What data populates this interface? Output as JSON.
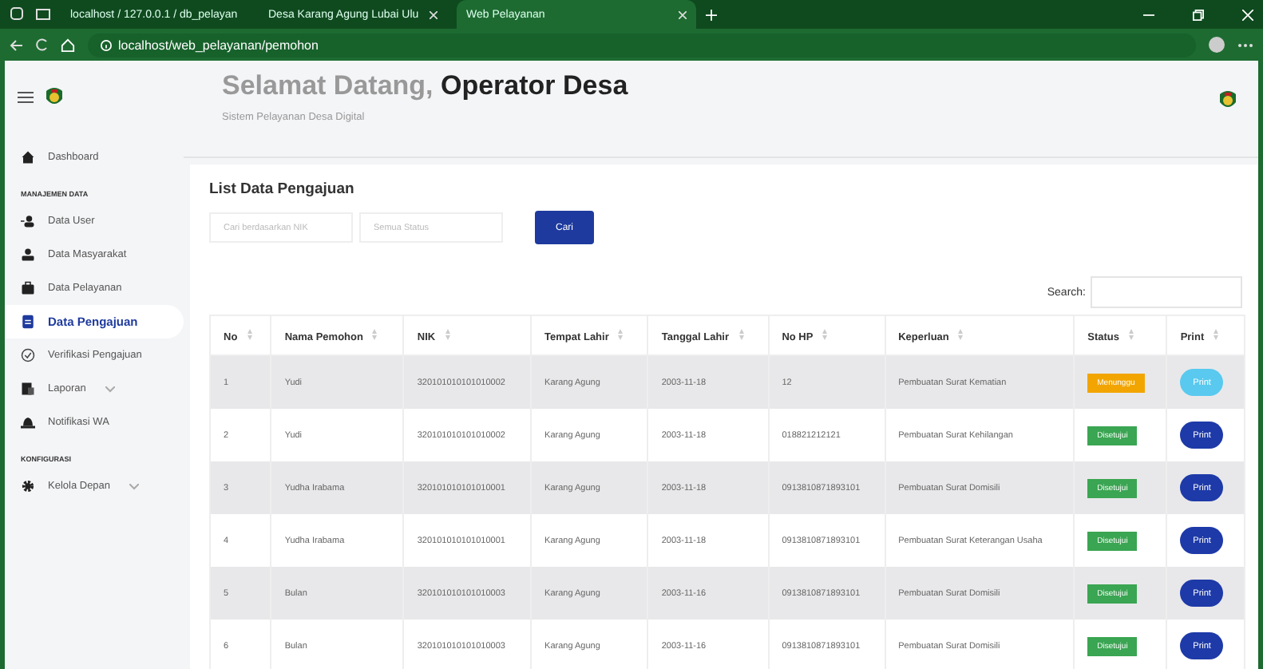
{
  "browser": {
    "tabs": [
      {
        "label": "localhost / 127.0.0.1 / db_pelayan",
        "selected": false
      },
      {
        "label": "Desa Karang Agung Lubai Ulu",
        "selected": false
      },
      {
        "label": "Web Pelayanan",
        "selected": true
      }
    ],
    "address": "localhost/web_pelayanan/pemohon"
  },
  "sidebar": {
    "items": [
      {
        "kind": "link",
        "label": "Dashboard",
        "selected": false
      },
      {
        "kind": "section",
        "label": "MANAJEMEN DATA"
      },
      {
        "kind": "link",
        "label": "Data User",
        "selected": false
      },
      {
        "kind": "link",
        "label": "Data Masyarakat",
        "selected": false
      },
      {
        "kind": "link",
        "label": "Data Pelayanan",
        "selected": false
      },
      {
        "kind": "link",
        "label": "Data Pengajuan",
        "selected": true
      },
      {
        "kind": "link",
        "label": "Verifikasi Pengajuan",
        "selected": false
      },
      {
        "kind": "link",
        "label": "Laporan",
        "selected": false,
        "expandable": true
      },
      {
        "kind": "link",
        "label": "Notifikasi WA",
        "selected": false
      },
      {
        "kind": "section",
        "label": "KONFIGURASI"
      },
      {
        "kind": "link",
        "label": "Kelola Depan",
        "selected": false,
        "expandable": true
      }
    ]
  },
  "header": {
    "greeting": "Selamat Datang, ",
    "user": "Operator Desa",
    "subtitle": "Sistem Pelayanan Desa Digital"
  },
  "card": {
    "title": "List Data Pengajuan",
    "filters": {
      "nik_placeholder": "Cari berdasarkan NIK",
      "status_placeholder": "Semua Status",
      "button": "Cari"
    },
    "search_label": "Search:",
    "table": {
      "columns": [
        "No",
        "Nama Pemohon",
        "NIK",
        "Tempat Lahir",
        "Tanggal Lahir",
        "No HP",
        "Keperluan",
        "Status",
        "Print"
      ],
      "rows": [
        {
          "cells": [
            "1",
            "Yudi",
            "320101010101010002",
            "Karang Agung",
            "2003-11-18",
            "12",
            "Pembuatan Surat Kematian"
          ],
          "status": {
            "label": "Menunggu",
            "kind": "pending"
          },
          "print": {
            "label": "Print",
            "disabled": true
          }
        },
        {
          "cells": [
            "2",
            "Yudi",
            "320101010101010002",
            "Karang Agung",
            "2003-11-18",
            "018821212121",
            "Pembuatan Surat Kehilangan"
          ],
          "status": {
            "label": "Disetujui",
            "kind": "approved"
          },
          "print": {
            "label": "Print",
            "disabled": false
          }
        },
        {
          "cells": [
            "3",
            "Yudha Irabama",
            "320101010101010001",
            "Karang Agung",
            "2003-11-18",
            "0913810871893101",
            "Pembuatan Surat Domisili"
          ],
          "status": {
            "label": "Disetujui",
            "kind": "approved"
          },
          "print": {
            "label": "Print",
            "disabled": false
          }
        },
        {
          "cells": [
            "4",
            "Yudha Irabama",
            "320101010101010001",
            "Karang Agung",
            "2003-11-18",
            "0913810871893101",
            "Pembuatan Surat Keterangan Usaha"
          ],
          "status": {
            "label": "Disetujui",
            "kind": "approved"
          },
          "print": {
            "label": "Print",
            "disabled": false
          }
        },
        {
          "cells": [
            "5",
            "Bulan",
            "320101010101010003",
            "Karang Agung",
            "2003-11-16",
            "0913810871893101",
            "Pembuatan Surat Domisili"
          ],
          "status": {
            "label": "Disetujui",
            "kind": "approved"
          },
          "print": {
            "label": "Print",
            "disabled": false
          }
        },
        {
          "cells": [
            "6",
            "Bulan",
            "320101010101010003",
            "Karang Agung",
            "2003-11-16",
            "0913810871893101",
            "Pembuatan Surat Domisili"
          ],
          "status": {
            "label": "Disetujui",
            "kind": "approved"
          },
          "print": {
            "label": "Print",
            "disabled": false
          }
        }
      ]
    }
  }
}
